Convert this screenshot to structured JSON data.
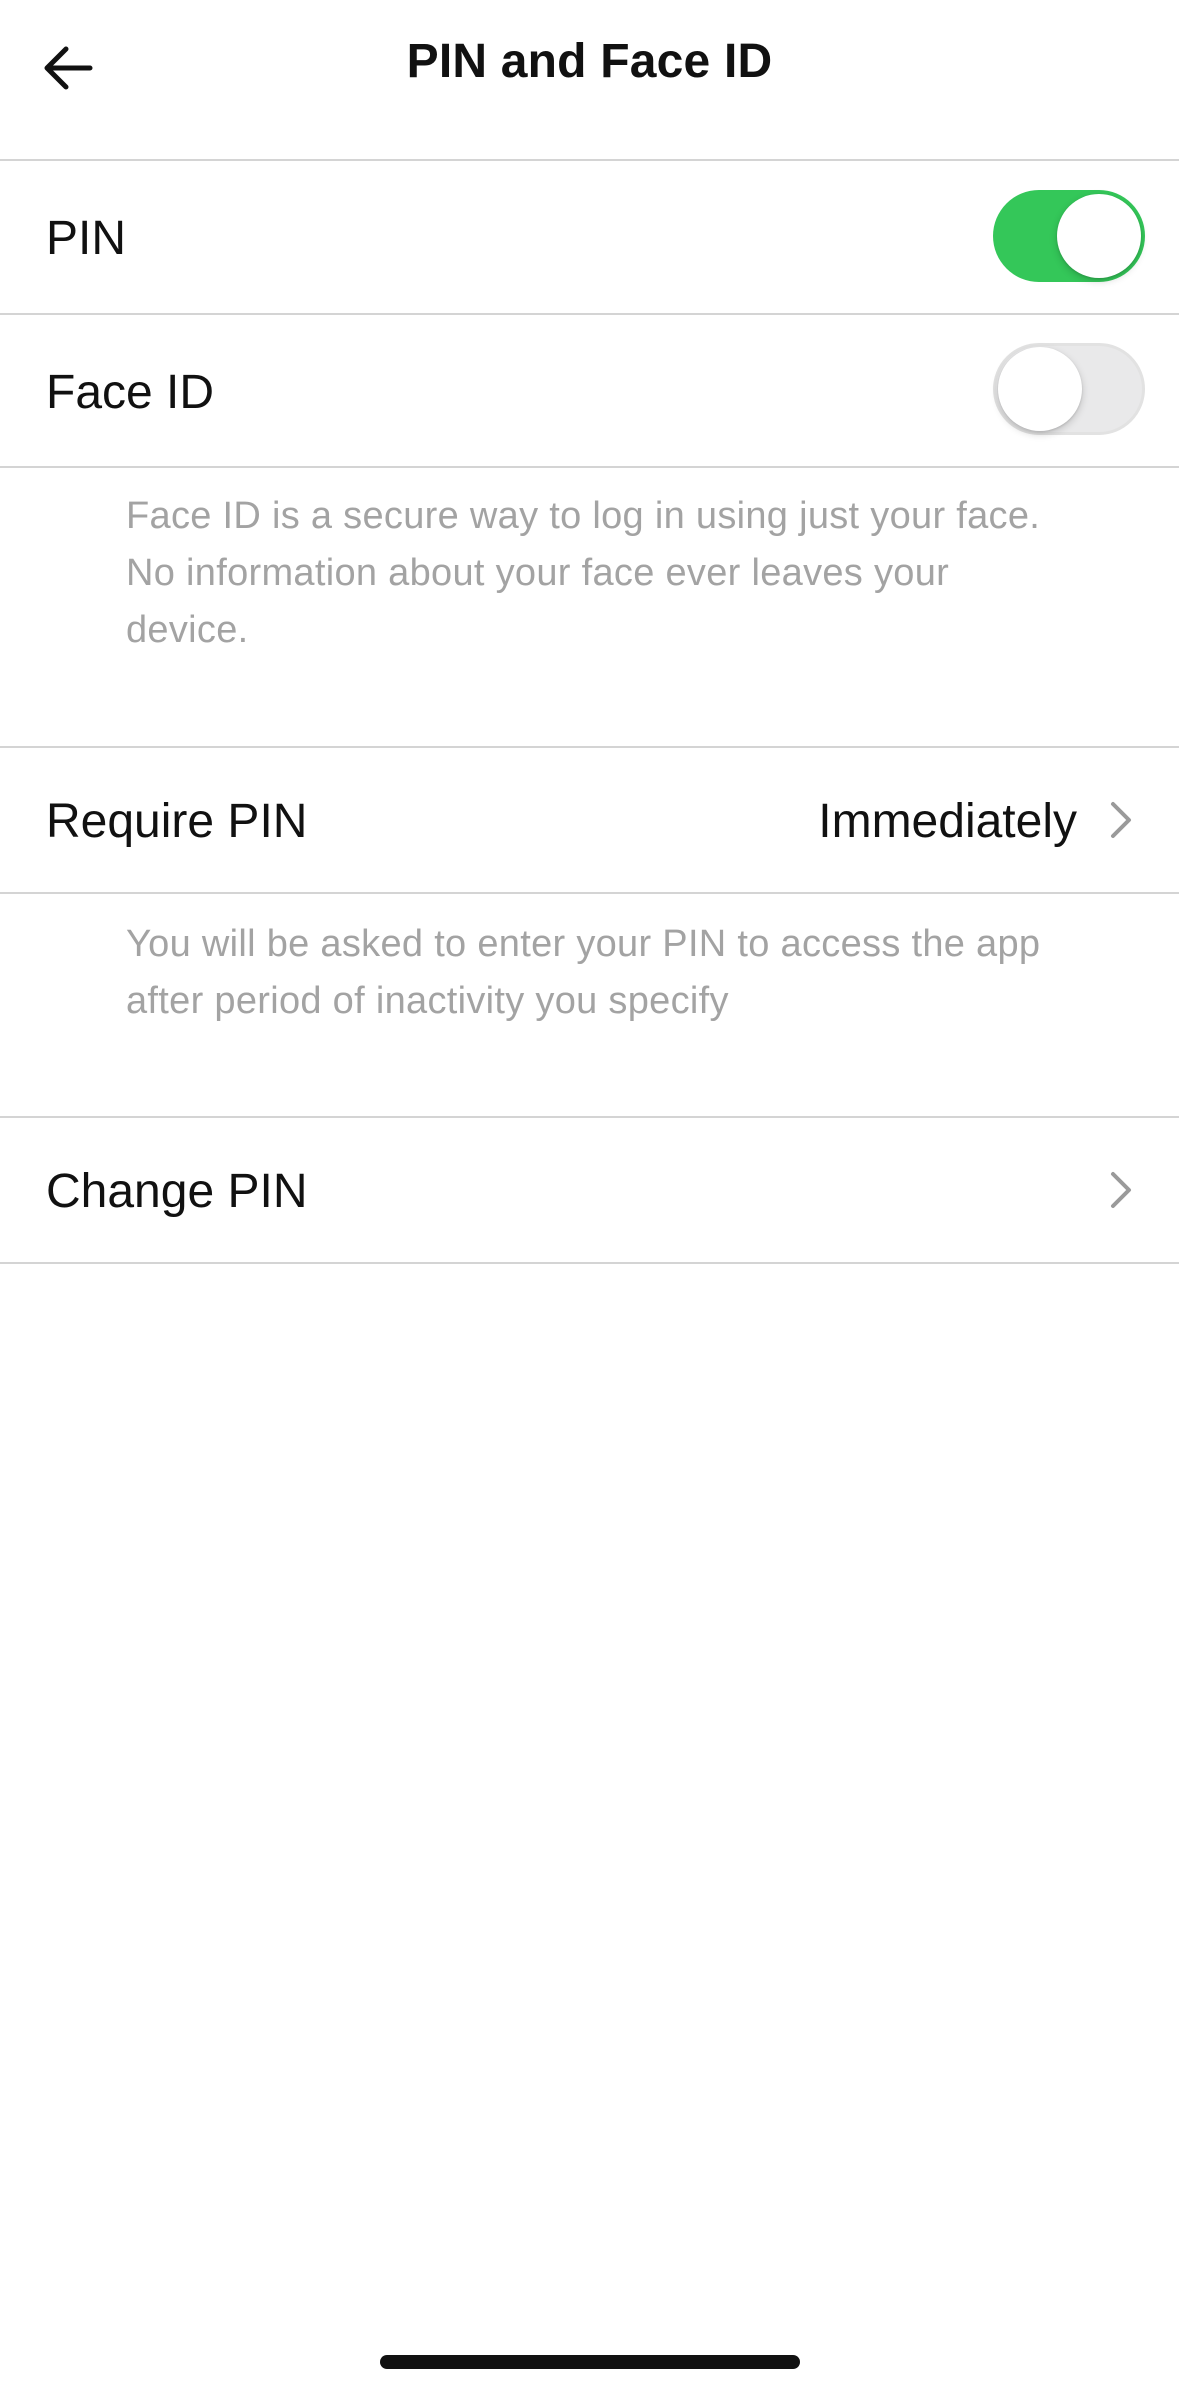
{
  "header": {
    "title": "PIN and Face ID",
    "back_icon": "arrow-left-icon"
  },
  "settings": {
    "pin": {
      "label": "PIN",
      "enabled": true
    },
    "face_id": {
      "label": "Face ID",
      "enabled": false,
      "description": "Face ID is a secure way to log in using just your face. No information about your face ever leaves your device."
    },
    "require_pin": {
      "label": "Require PIN",
      "value": "Immediately",
      "description": "You will be asked to enter your PIN to access the app after period of inactivity you specify"
    },
    "change_pin": {
      "label": "Change PIN"
    }
  },
  "colors": {
    "accent": "#34c759",
    "footnote": "#a3a3a3",
    "divider": "#d4d4d4"
  },
  "icons": {
    "chevron": "chevron-right-icon"
  }
}
